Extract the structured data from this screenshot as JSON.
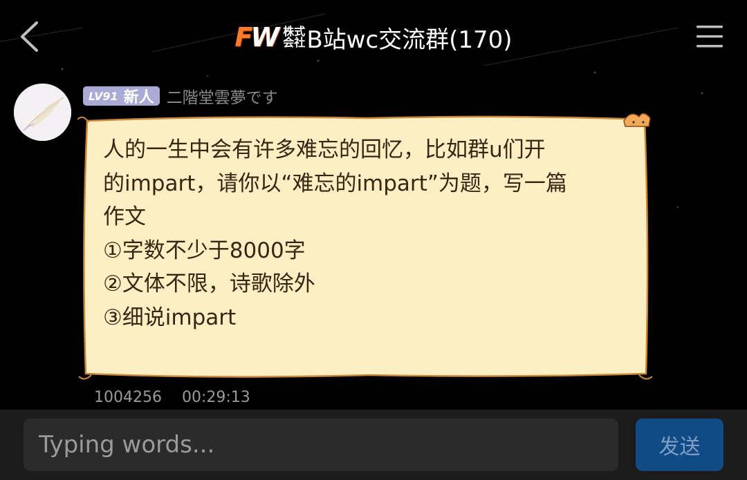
{
  "header": {
    "back_icon": "chevron-left-icon",
    "logo_text": "FW",
    "corp_line1": "株式",
    "corp_line2": "会社",
    "title": "B站wc交流群(170)",
    "menu_icon": "hamburger-menu-icon"
  },
  "message": {
    "avatar_icon": "feather-avatar",
    "level": "LV91",
    "member_title": "新人",
    "username": "二階堂雲夢です",
    "text": "人的一生中会有许多难忘的回忆，比如群u们开\n的impart，请你以“难忘的impart”为题，写一篇\n作文\n①字数不少于8000字\n②文体不限，诗歌除外\n③细说impart",
    "bubble_color": "#fcefc4",
    "bubble_border": "#c9883a",
    "sender_id": "1004256",
    "time": "00:29:13"
  },
  "composer": {
    "placeholder": "Typing words...",
    "send_label": "发送",
    "send_color": "#114b86"
  }
}
